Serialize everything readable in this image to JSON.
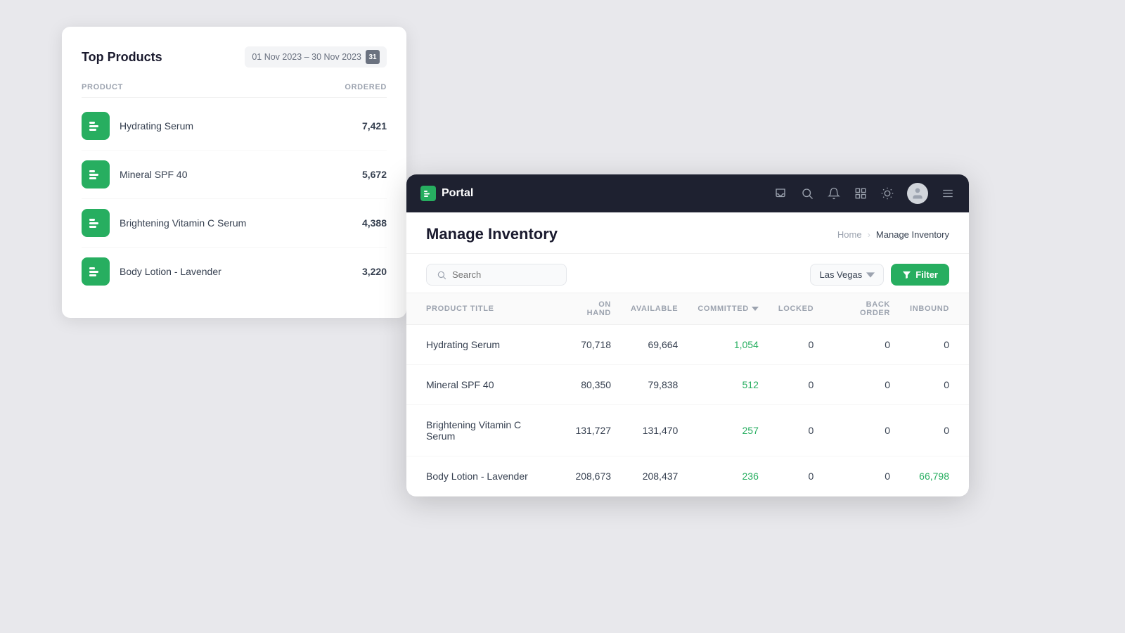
{
  "topProducts": {
    "title": "Top Products",
    "dateRange": "01 Nov 2023 – 30 Nov 2023",
    "calDay": "31",
    "columns": {
      "product": "PRODUCT",
      "ordered": "ORDERED"
    },
    "items": [
      {
        "name": "Hydrating Serum",
        "ordered": "7,421"
      },
      {
        "name": "Mineral SPF 40",
        "ordered": "5,672"
      },
      {
        "name": "Brightening Vitamin C Serum",
        "ordered": "4,388"
      },
      {
        "name": "Body Lotion - Lavender",
        "ordered": "3,220"
      }
    ]
  },
  "portal": {
    "logoText": "Portal",
    "pageTitle": "Manage Inventory",
    "breadcrumb": {
      "home": "Home",
      "current": "Manage Inventory"
    },
    "search": {
      "placeholder": "Search"
    },
    "location": "Las Vegas",
    "filterLabel": "Filter",
    "table": {
      "columns": {
        "productTitle": "PRODUCT TITLE",
        "onHand": "ON HAND",
        "available": "AVAILABLE",
        "committed": "COMMITTED",
        "locked": "LOCKED",
        "backOrder": "BACK ORDER",
        "inbound": "INBOUND"
      },
      "rows": [
        {
          "name": "Hydrating Serum",
          "onHand": "70,718",
          "available": "69,664",
          "committed": "1,054",
          "locked": "0",
          "backOrder": "0",
          "inbound": "0",
          "inboundGreen": false
        },
        {
          "name": "Mineral SPF 40",
          "onHand": "80,350",
          "available": "79,838",
          "committed": "512",
          "locked": "0",
          "backOrder": "0",
          "inbound": "0",
          "inboundGreen": false
        },
        {
          "name": "Brightening Vitamin C Serum",
          "onHand": "131,727",
          "available": "131,470",
          "committed": "257",
          "locked": "0",
          "backOrder": "0",
          "inbound": "0",
          "inboundGreen": false
        },
        {
          "name": "Body Lotion - Lavender",
          "onHand": "208,673",
          "available": "208,437",
          "committed": "236",
          "locked": "0",
          "backOrder": "0",
          "inbound": "66,798",
          "inboundGreen": true
        }
      ]
    }
  },
  "colors": {
    "green": "#27ae60",
    "dark": "#1e2130"
  }
}
